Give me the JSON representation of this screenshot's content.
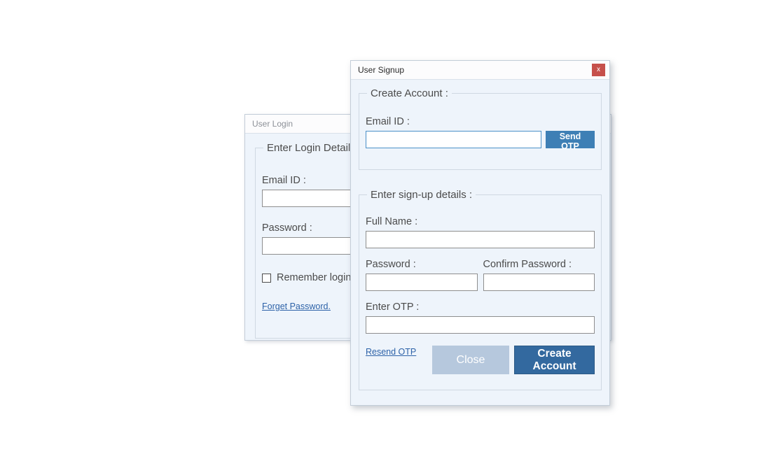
{
  "login_window": {
    "title": "User Login",
    "group_legend": "Enter Login Details :",
    "email_label": "Email ID :",
    "email_value": "",
    "password_label": "Password :",
    "password_value": "",
    "remember_label": "Remember login details",
    "forget_password_link": "Forget Password."
  },
  "signup_window": {
    "title": "User Signup",
    "close_button": "x",
    "create_account_group": {
      "legend": "Create Account :",
      "email_label": "Email ID :",
      "email_value": "",
      "send_otp_button": "Send OTP"
    },
    "signup_details_group": {
      "legend": "Enter sign-up details :",
      "full_name_label": "Full Name :",
      "full_name_value": "",
      "password_label": "Password :",
      "password_value": "",
      "confirm_password_label": "Confirm Password :",
      "confirm_password_value": "",
      "otp_label": "Enter OTP :",
      "otp_value": "",
      "resend_otp_link": "Resend OTP",
      "close_button": "Close",
      "create_account_button": "Create Account"
    }
  },
  "colors": {
    "window_background": "#eef4fb",
    "titlebar": "#fcfcfd",
    "close_red": "#c6504b",
    "send_otp_blue": "#3e7fb5",
    "create_account_blue": "#33699f",
    "close_disabled_blue": "#b6c8dd",
    "link_blue": "#2d62a8",
    "focus_border": "#4a90c8",
    "input_border": "#8e8e8e",
    "group_border": "#cfd8e2"
  }
}
